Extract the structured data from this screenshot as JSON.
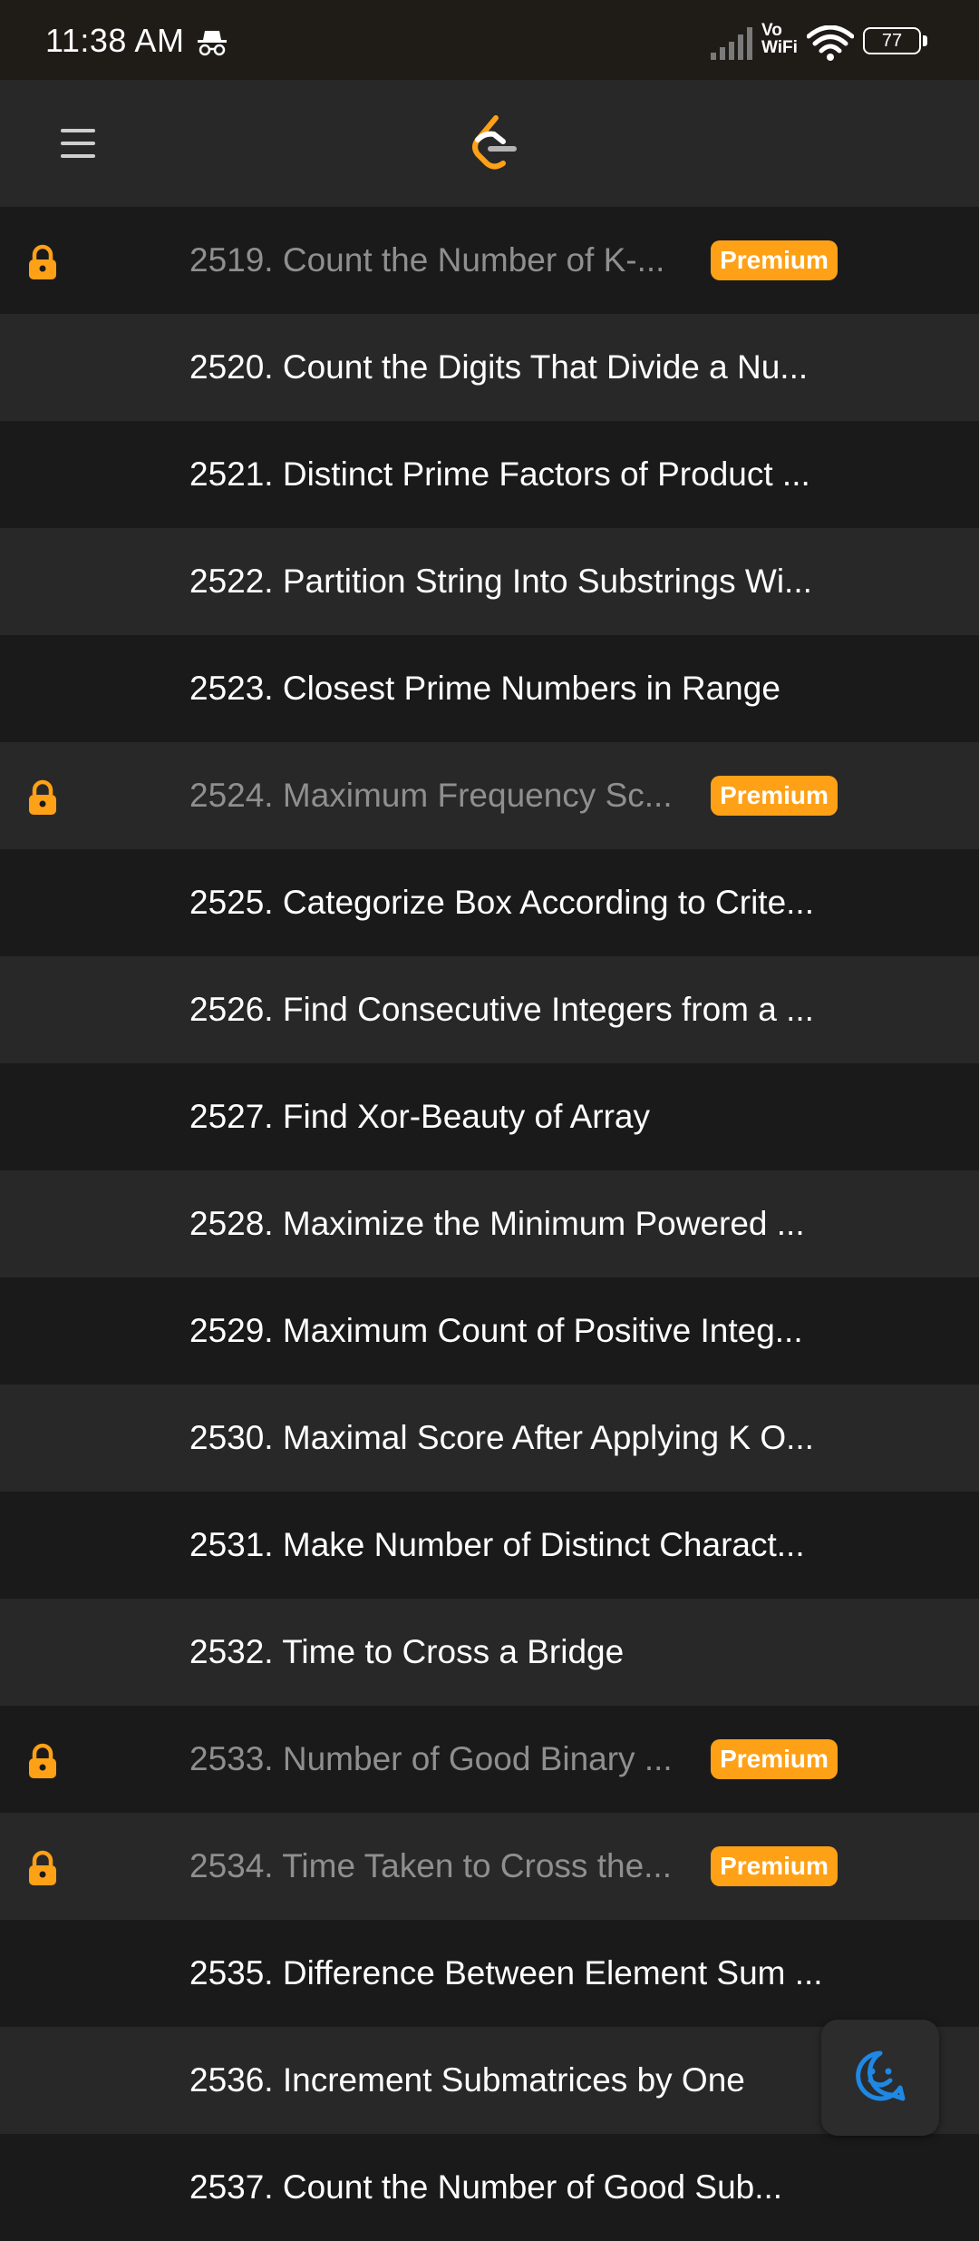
{
  "status_bar": {
    "time": "11:38 AM",
    "vowifi_top": "Vo",
    "vowifi_bottom": "WiFi",
    "battery": "77",
    "icons": [
      "incognito-icon",
      "signal-icon",
      "wifi-icon",
      "battery-icon"
    ]
  },
  "header": {
    "menu_icon": "hamburger-menu-icon",
    "logo": "leetcode-logo"
  },
  "colors": {
    "accent": "#ffa116",
    "row_dark": "#1a1a1a",
    "row_light": "#282828",
    "locked_text": "#8f8f8f",
    "feedback_icon": "#1e88e5"
  },
  "problems": [
    {
      "title": "2519. Count the Number of K-...",
      "premium": true
    },
    {
      "title": "2520. Count the Digits That Divide a Nu...",
      "premium": false
    },
    {
      "title": "2521. Distinct Prime Factors of Product ...",
      "premium": false
    },
    {
      "title": "2522. Partition String Into Substrings Wi...",
      "premium": false
    },
    {
      "title": "2523. Closest Prime Numbers in Range",
      "premium": false
    },
    {
      "title": "2524. Maximum Frequency Sc...",
      "premium": true
    },
    {
      "title": "2525. Categorize Box According to Crite...",
      "premium": false
    },
    {
      "title": "2526. Find Consecutive Integers from a ...",
      "premium": false
    },
    {
      "title": "2527. Find Xor-Beauty of Array",
      "premium": false
    },
    {
      "title": "2528. Maximize the Minimum Powered ...",
      "premium": false
    },
    {
      "title": "2529. Maximum Count of Positive Integ...",
      "premium": false
    },
    {
      "title": "2530. Maximal Score After Applying K O...",
      "premium": false
    },
    {
      "title": "2531. Make Number of Distinct Charact...",
      "premium": false
    },
    {
      "title": "2532. Time to Cross a Bridge",
      "premium": false
    },
    {
      "title": "2533. Number of Good Binary ...",
      "premium": true
    },
    {
      "title": "2534. Time Taken to Cross the...",
      "premium": true
    },
    {
      "title": "2535. Difference Between Element Sum ...",
      "premium": false
    },
    {
      "title": "2536. Increment Submatrices by One",
      "premium": false
    },
    {
      "title": "2537. Count the Number of Good Sub...",
      "premium": false
    }
  ],
  "premium_label": "Premium",
  "feedback_icon": "smiley-face-icon"
}
